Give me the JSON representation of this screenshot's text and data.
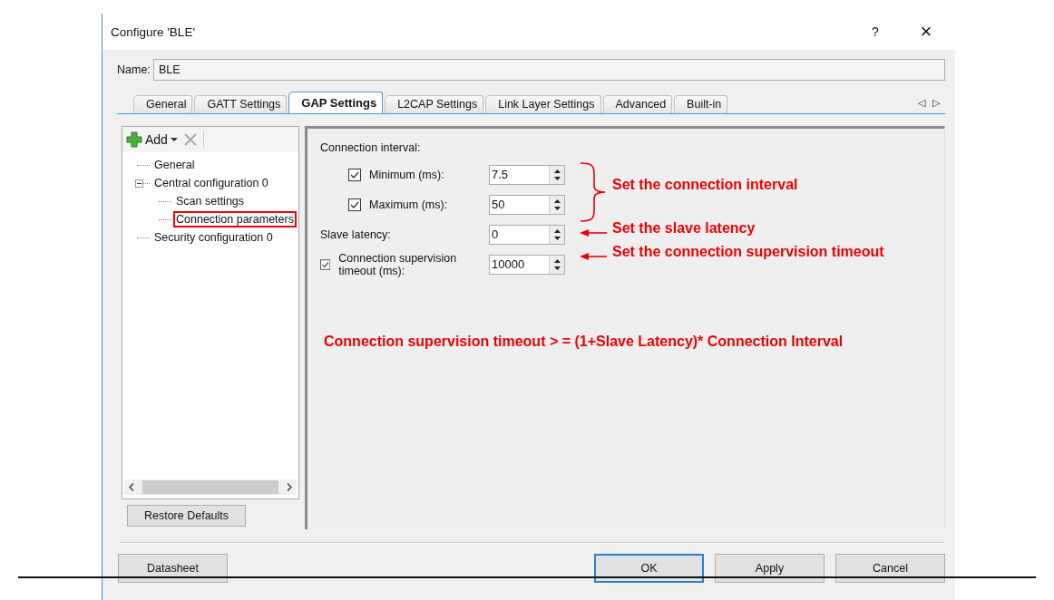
{
  "window": {
    "title": "Configure 'BLE'",
    "help": "?",
    "close": "×"
  },
  "name_field": {
    "label": "Name:",
    "value": "BLE"
  },
  "tabs": [
    {
      "label": "General",
      "selected": false
    },
    {
      "label": "GATT Settings",
      "selected": false
    },
    {
      "label": "GAP Settings",
      "selected": true
    },
    {
      "label": "L2CAP Settings",
      "selected": false
    },
    {
      "label": "Link Layer Settings",
      "selected": false
    },
    {
      "label": "Advanced",
      "selected": false
    },
    {
      "label": "Built-in",
      "selected": false
    }
  ],
  "tab_scroll": {
    "left": "◁",
    "right": "▷"
  },
  "tree_toolbar": {
    "add": "Add"
  },
  "tree": [
    {
      "label": "General",
      "highlighted": false
    },
    {
      "label": "Central configuration 0",
      "highlighted": false,
      "expanded": true,
      "children": [
        {
          "label": "Scan settings",
          "highlighted": false
        },
        {
          "label": "Connection parameters",
          "highlighted": true
        }
      ]
    },
    {
      "label": "Security configuration 0",
      "highlighted": false
    }
  ],
  "restore_button": "Restore Defaults",
  "settings": {
    "group_label": "Connection interval:",
    "rows": [
      {
        "kind": "checkbox",
        "label": "Minimum (ms):",
        "checked": true,
        "indent": true,
        "value": "7.5"
      },
      {
        "kind": "checkbox",
        "label": "Maximum (ms):",
        "checked": true,
        "indent": true,
        "value": "50"
      },
      {
        "kind": "plain",
        "label": "Slave latency:",
        "indent": false,
        "value": "0"
      },
      {
        "kind": "checkbox",
        "label": "Connection supervision timeout (ms):",
        "checked": true,
        "indent": false,
        "value": "10000"
      }
    ]
  },
  "annotations": [
    {
      "kind": "brace",
      "text": "Set the connection interval"
    },
    {
      "kind": "arrow",
      "text": "Set the slave latency"
    },
    {
      "kind": "arrow",
      "text": "Set the connection supervision timeout"
    }
  ],
  "formula": "Connection supervision timeout  > = (1+Slave Latency)* Connection Interval",
  "buttons": [
    {
      "label": "Datasheet",
      "default": false
    },
    {
      "label": "OK",
      "default": true
    },
    {
      "label": "Apply",
      "default": false
    },
    {
      "label": "Cancel",
      "default": false
    }
  ]
}
